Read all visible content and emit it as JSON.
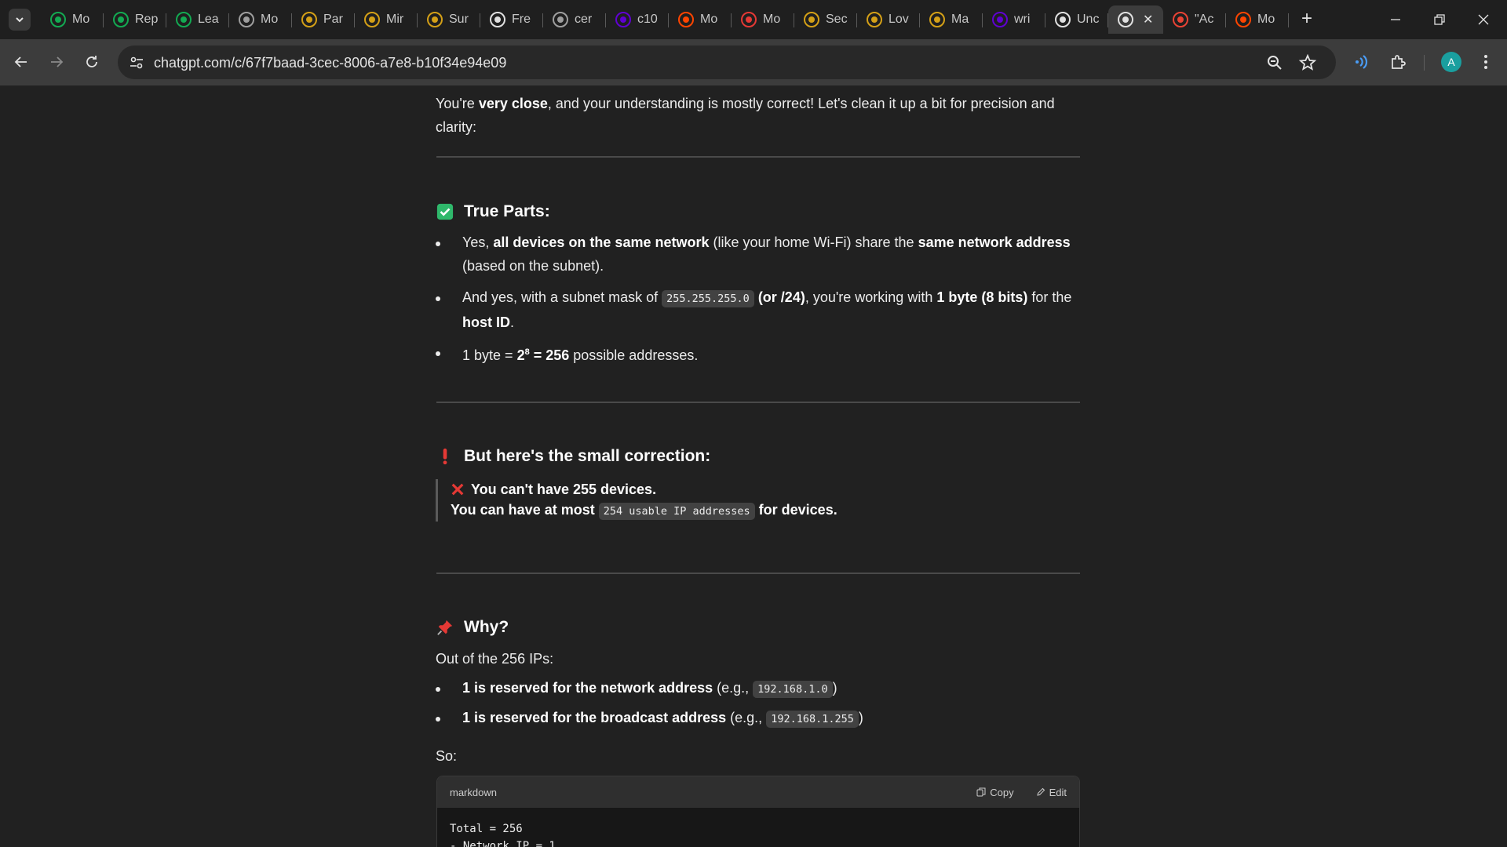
{
  "browser": {
    "tabs": [
      {
        "title": "Mo",
        "icon": "mongodb-leaf-icon",
        "color": "#13aa52"
      },
      {
        "title": "Rep",
        "icon": "mongodb-leaf-icon",
        "color": "#13aa52"
      },
      {
        "title": "Lea",
        "icon": "mongodb-circle-icon",
        "color": "#13aa52"
      },
      {
        "title": "Mo",
        "icon": "aig-circle-icon",
        "color": "#9e9e9e"
      },
      {
        "title": "Par",
        "icon": "swirl-icon",
        "color": "#d4a017"
      },
      {
        "title": "Mir",
        "icon": "swirl-icon",
        "color": "#d4a017"
      },
      {
        "title": "Sur",
        "icon": "swirl-icon",
        "color": "#d4a017"
      },
      {
        "title": "Fre",
        "icon": "mail-window-icon",
        "color": "#e0e0e0"
      },
      {
        "title": "cer",
        "icon": "pin-icon",
        "color": "#9e9e9e"
      },
      {
        "title": "c10",
        "icon": "yahoo-y-icon",
        "color": "#6001d2"
      },
      {
        "title": "Mo",
        "icon": "reddit-icon",
        "color": "#ff4500"
      },
      {
        "title": "Mo",
        "icon": "c-logo-icon",
        "color": "#e53935"
      },
      {
        "title": "Sec",
        "icon": "swirl-icon",
        "color": "#d4a017"
      },
      {
        "title": "Lov",
        "icon": "bolt-icon",
        "color": "#d4a017"
      },
      {
        "title": "Ma",
        "icon": "bolt-icon",
        "color": "#d4a017"
      },
      {
        "title": "wri",
        "icon": "yahoo-y-icon",
        "color": "#6001d2"
      },
      {
        "title": "Unc",
        "icon": "mc-circle-icon",
        "color": "#e0e0e0"
      },
      {
        "title": "",
        "icon": "chatgpt-icon",
        "color": "#e0e0e0",
        "active": true
      },
      {
        "title": "\"Ac",
        "icon": "gmail-icon",
        "color": "#ea4335"
      },
      {
        "title": "Mo",
        "icon": "reddit-icon",
        "color": "#ff4500"
      }
    ],
    "url": "chatgpt.com/c/67f7baad-3cec-8006-a7e8-b10f34e94e09",
    "profile_initial": "A"
  },
  "message": {
    "intro_pre": "You're ",
    "intro_bold": "very close",
    "intro_post": ", and your understanding is mostly correct! Let's clean it up a bit for precision and clarity:",
    "true_parts": {
      "heading": "True Parts:",
      "b1": {
        "t1": "Yes, ",
        "b1": "all devices on the same network",
        "t2": " (like your home Wi-Fi) share the ",
        "b2": "same network address",
        "t3": " (based on the subnet)."
      },
      "b2": {
        "t1": "And yes, with a subnet mask of ",
        "code": "255.255.255.0",
        "b1": " (or /24)",
        "t2": ", you're working with ",
        "b2": "1 byte (8 bits)",
        "t3": " for the ",
        "b3": "host ID",
        "t4": "."
      },
      "b3": {
        "t1": "1 byte = ",
        "base": "2",
        "exp": "8",
        "b1": " = 256",
        "t2": " possible addresses."
      }
    },
    "correction": {
      "heading": "But here's the small correction:",
      "line1": "You can't have 255 devices.",
      "line2_pre": "You can have at most ",
      "line2_code": "254 usable IP addresses",
      "line2_post": " for devices."
    },
    "why": {
      "heading": "Why?",
      "intro": "Out of the 256 IPs:",
      "b1": {
        "bold": "1 is reserved for the network address",
        "t1": " (e.g., ",
        "code": "192.168.1.0",
        "t2": ")"
      },
      "b2": {
        "bold": "1 is reserved for the broadcast address",
        "t1": " (e.g., ",
        "code": "192.168.1.255",
        "t2": ")"
      },
      "so": "So:"
    },
    "codeblock": {
      "lang": "markdown",
      "copy_label": "Copy",
      "edit_label": "Edit",
      "lines": "Total = 256\n- Network IP = 1"
    }
  }
}
